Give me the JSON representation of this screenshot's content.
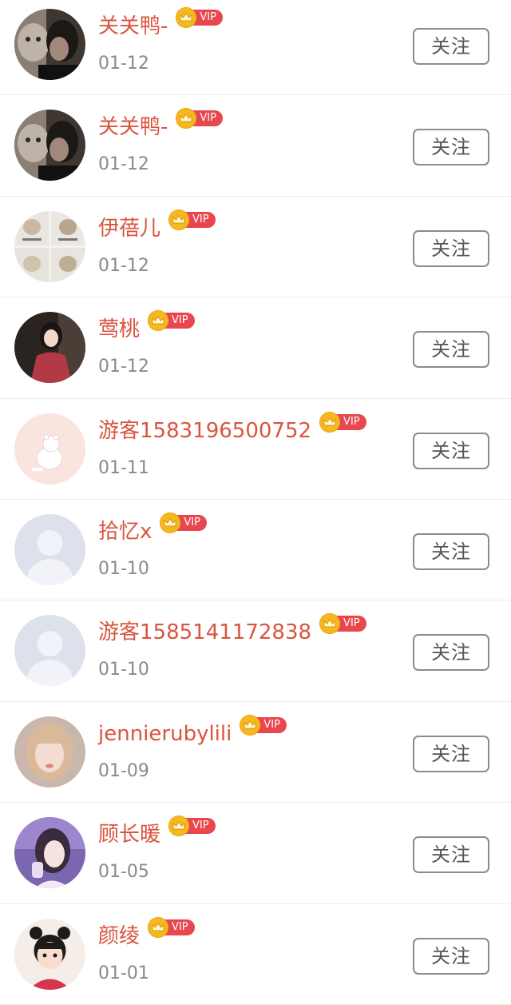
{
  "colors": {
    "name": "#d9553f",
    "date": "#8a8a8a",
    "vip_tag": "#e9474e",
    "vip_crown": "#f5b820",
    "follow_border": "#8c8c8c"
  },
  "list": [
    {
      "name": "关关鸭-",
      "vip": "VIP",
      "date": "01-12",
      "follow": "关注",
      "avatar": "photo-couple-cat-avatar"
    },
    {
      "name": "关关鸭-",
      "vip": "VIP",
      "date": "01-12",
      "follow": "关注",
      "avatar": "photo-couple-cat-avatar"
    },
    {
      "name": "伊蓓儿",
      "vip": "VIP",
      "date": "01-12",
      "follow": "关注",
      "avatar": "cat-grid-avatar"
    },
    {
      "name": "莺桃",
      "vip": "VIP",
      "date": "01-12",
      "follow": "关注",
      "avatar": "photo-girl-red-avatar"
    },
    {
      "name": "游客1583196500752",
      "vip": "VIP",
      "date": "01-11",
      "follow": "关注",
      "avatar": "pink-polar-bear-avatar"
    },
    {
      "name": "拾忆x",
      "vip": "VIP",
      "date": "01-10",
      "follow": "关注",
      "avatar": "default-user-avatar"
    },
    {
      "name": "游客1585141172838",
      "vip": "VIP",
      "date": "01-10",
      "follow": "关注",
      "avatar": "default-user-avatar"
    },
    {
      "name": "jennierubylili",
      "vip": "VIP",
      "date": "01-09",
      "follow": "关注",
      "avatar": "photo-girl-blonde-avatar"
    },
    {
      "name": "顾长暖",
      "vip": "VIP",
      "date": "01-05",
      "follow": "关注",
      "avatar": "photo-girl-purple-avatar"
    },
    {
      "name": "颜绫",
      "vip": "VIP",
      "date": "01-01",
      "follow": "关注",
      "avatar": "cartoon-girl-avatar"
    }
  ]
}
